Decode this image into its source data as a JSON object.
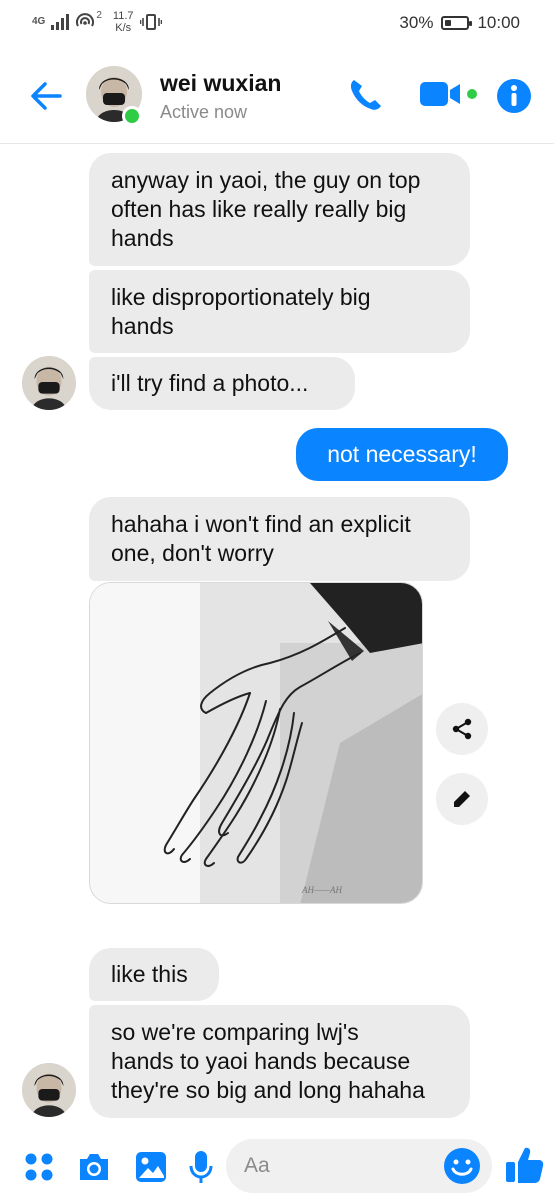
{
  "status_bar": {
    "network": "4G",
    "speed_value": "11.7",
    "speed_unit": "K/s",
    "hotspot_badge": "2",
    "battery_percent_text": "30%",
    "battery_level": 0.3,
    "time": "10:00"
  },
  "header": {
    "name": "wei wuxian",
    "status": "Active now"
  },
  "messages": [
    {
      "id": "m1",
      "direction": "incoming",
      "text": "anyway in yaoi, the guy on top often has like really really big hands"
    },
    {
      "id": "m2",
      "direction": "incoming",
      "text": "like disproportionately big hands"
    },
    {
      "id": "m3",
      "direction": "incoming",
      "text": "i'll try find a photo..."
    },
    {
      "id": "m4",
      "direction": "outgoing",
      "text": "not necessary!"
    },
    {
      "id": "m5",
      "direction": "incoming",
      "text": "hahaha i won't find an explicit one, don't worry"
    },
    {
      "id": "m6",
      "direction": "incoming",
      "type": "image",
      "watermark": "AH——AH"
    },
    {
      "id": "m7",
      "direction": "incoming",
      "text": "like this"
    },
    {
      "id": "m8",
      "direction": "incoming",
      "text": "so we're comparing lwj's hands to yaoi hands because they're so big and long hahaha"
    }
  ],
  "m1": {
    "lines": [
      "anyway in yaoi, the guy on top",
      "often has like really really big",
      "hands"
    ]
  },
  "m2": {
    "lines": [
      "like disproportionately big",
      "hands"
    ]
  },
  "m3": {
    "lines": [
      "i'll try find a photo..."
    ]
  },
  "m4": {
    "lines": [
      "not necessary!"
    ]
  },
  "m5": {
    "lines": [
      "hahaha i won't find an explicit",
      "one, don't worry"
    ]
  },
  "m7": {
    "lines": [
      "like this"
    ]
  },
  "m8": {
    "lines": [
      "so we're comparing lwj's",
      "hands to yaoi hands because",
      "they're so big and long hahaha"
    ]
  },
  "photo_actions": {
    "share_icon": "share-icon",
    "edit_icon": "pencil-icon"
  },
  "composer": {
    "placeholder": "Aa",
    "icons": [
      "apps-icon",
      "camera-icon",
      "gallery-icon",
      "microphone-icon",
      "emoji-icon",
      "thumbs-up-icon"
    ]
  },
  "colors": {
    "accent": "#0a84ff",
    "incoming_bubble": "#ebebeb",
    "online": "#31cc46"
  }
}
